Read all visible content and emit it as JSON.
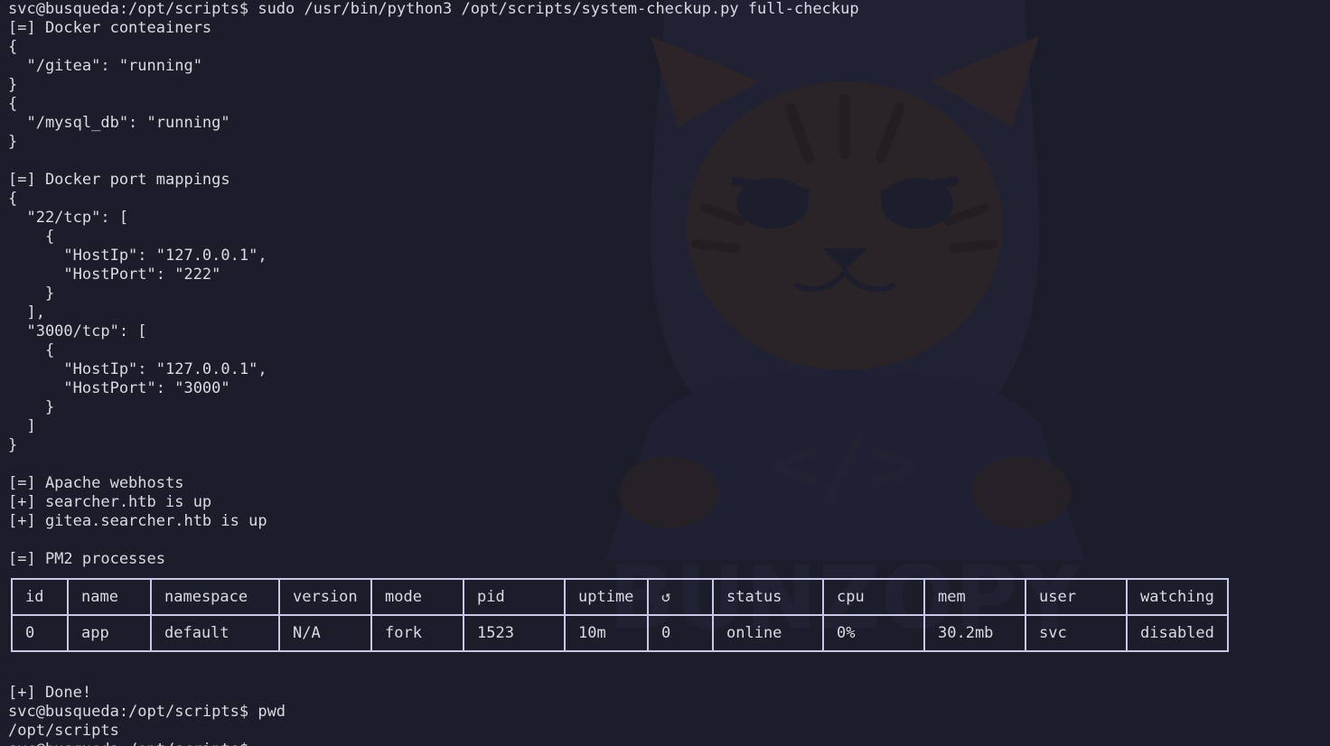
{
  "terminal": {
    "lines_top": [
      "svc@busqueda:/opt/scripts$ sudo /usr/bin/python3 /opt/scripts/system-checkup.py full-checkup",
      "[=] Docker conteainers",
      "{",
      "  \"/gitea\": \"running\"",
      "}",
      "{",
      "  \"/mysql_db\": \"running\"",
      "}",
      "",
      "[=] Docker port mappings",
      "{",
      "  \"22/tcp\": [",
      "    {",
      "      \"HostIp\": \"127.0.0.1\",",
      "      \"HostPort\": \"222\"",
      "    }",
      "  ],",
      "  \"3000/tcp\": [",
      "    {",
      "      \"HostIp\": \"127.0.0.1\",",
      "      \"HostPort\": \"3000\"",
      "    }",
      "  ]",
      "}",
      "",
      "[=] Apache webhosts",
      "[+] searcher.htb is up",
      "[+] gitea.searcher.htb is up",
      "",
      "[=] PM2 processes"
    ],
    "lines_bottom": [
      "[+] Done!",
      "svc@busqueda:/opt/scripts$ pwd",
      "/opt/scripts",
      "svc@busqueda:/opt/scripts$ "
    ]
  },
  "pm2_table": {
    "headers": [
      "id",
      "name",
      "namespace",
      "version",
      "mode",
      "pid",
      "uptime",
      "↺",
      "status",
      "cpu",
      "mem",
      "user",
      "watching"
    ],
    "rows": [
      [
        "0",
        "app",
        "default",
        "N/A",
        "fork",
        "1523",
        "10m",
        "0",
        "online",
        "0%",
        "30.2mb",
        "svc",
        "disabled"
      ]
    ]
  },
  "watermark": {
    "text": "BUNZOPY",
    "code_glyph": "</>",
    "icon": "hooded-cat-hacker-icon"
  },
  "colors": {
    "background": "#1c1d2b",
    "foreground": "#d9dbe4",
    "table_border": "#c6c8e6",
    "watermark_accent": "#3a2a26"
  }
}
